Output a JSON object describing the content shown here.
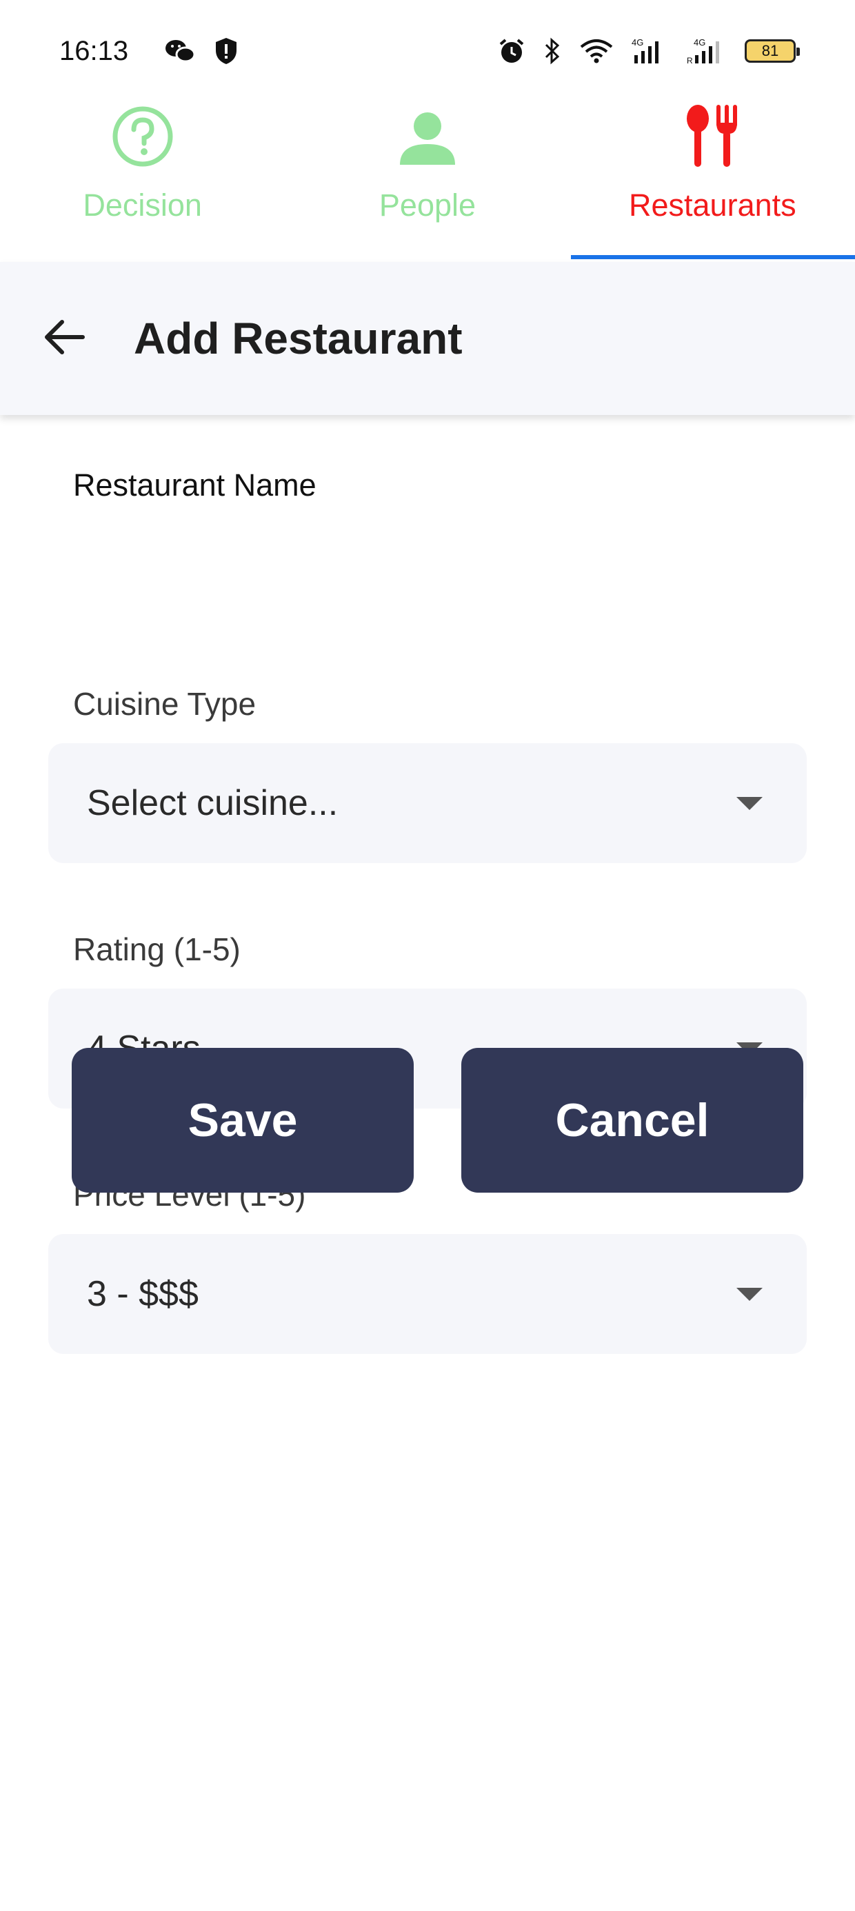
{
  "status_bar": {
    "time": "16:13",
    "icons_left": [
      "wechat-icon",
      "shield-icon"
    ],
    "icons_right": [
      "alarm-icon",
      "bluetooth-icon",
      "wifi-icon",
      "signal-4g-icon",
      "signal-4g-roaming-icon"
    ],
    "battery_level": "81"
  },
  "tabs": [
    {
      "label": "Decision",
      "icon": "question-circle-icon",
      "active": false
    },
    {
      "label": "People",
      "icon": "person-icon",
      "active": false
    },
    {
      "label": "Restaurants",
      "icon": "utensils-icon",
      "active": true
    }
  ],
  "colors": {
    "tab_inactive": "#95e39c",
    "tab_active": "#f21b1b",
    "tab_indicator": "#1a73e8",
    "button_bg": "#323857",
    "field_bg": "#f5f6fa"
  },
  "header": {
    "title": "Add Restaurant",
    "back_icon": "arrow-left-icon"
  },
  "form": {
    "name": {
      "label": "Restaurant Name",
      "value": ""
    },
    "cuisine": {
      "label": "Cuisine Type",
      "value": "Select cuisine..."
    },
    "rating": {
      "label": "Rating (1-5)",
      "value": "4 Stars"
    },
    "price": {
      "label": "Price Level (1-5)",
      "value": "3 - $$$"
    }
  },
  "buttons": {
    "save": "Save",
    "cancel": "Cancel"
  }
}
